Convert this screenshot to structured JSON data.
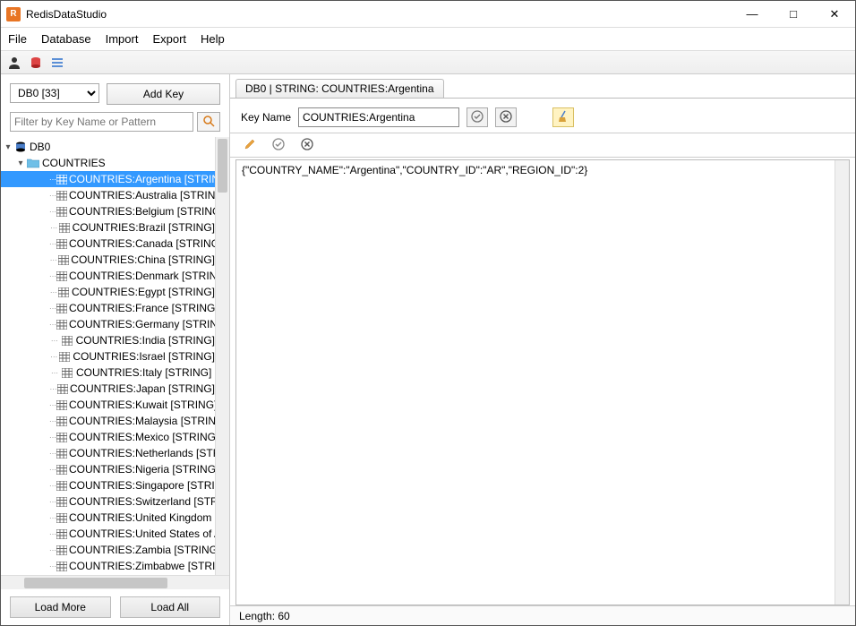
{
  "app": {
    "title": "RedisDataStudio"
  },
  "menu": {
    "file": "File",
    "database": "Database",
    "import": "Import",
    "export": "Export",
    "help": "Help"
  },
  "sidebar": {
    "db_selector": "DB0 [33]",
    "add_key": "Add Key",
    "filter_placeholder": "Filter by Key Name or Pattern",
    "root_label": "DB0",
    "folder_label": "COUNTRIES",
    "keys": [
      "COUNTRIES:Argentina [STRING]",
      "COUNTRIES:Australia [STRING]",
      "COUNTRIES:Belgium [STRING]",
      "COUNTRIES:Brazil [STRING]",
      "COUNTRIES:Canada [STRING]",
      "COUNTRIES:China [STRING]",
      "COUNTRIES:Denmark [STRING]",
      "COUNTRIES:Egypt [STRING]",
      "COUNTRIES:France [STRING]",
      "COUNTRIES:Germany [STRING]",
      "COUNTRIES:India [STRING]",
      "COUNTRIES:Israel [STRING]",
      "COUNTRIES:Italy [STRING]",
      "COUNTRIES:Japan [STRING]",
      "COUNTRIES:Kuwait [STRING]",
      "COUNTRIES:Malaysia [STRING]",
      "COUNTRIES:Mexico [STRING]",
      "COUNTRIES:Netherlands [STRING]",
      "COUNTRIES:Nigeria [STRING]",
      "COUNTRIES:Singapore [STRING]",
      "COUNTRIES:Switzerland [STRING]",
      "COUNTRIES:United Kingdom [STRING]",
      "COUNTRIES:United States of America [STRING]",
      "COUNTRIES:Zambia [STRING]",
      "COUNTRIES:Zimbabwe [STRING]"
    ],
    "selected_index": 0,
    "load_more": "Load More",
    "load_all": "Load All"
  },
  "main": {
    "tab_title": "DB0 | STRING: COUNTRIES:Argentina",
    "key_name_label": "Key Name",
    "key_name_value": "COUNTRIES:Argentina",
    "value_text": "{\"COUNTRY_NAME\":\"Argentina\",\"COUNTRY_ID\":\"AR\",\"REGION_ID\":2}",
    "status_length": "Length: 60"
  }
}
